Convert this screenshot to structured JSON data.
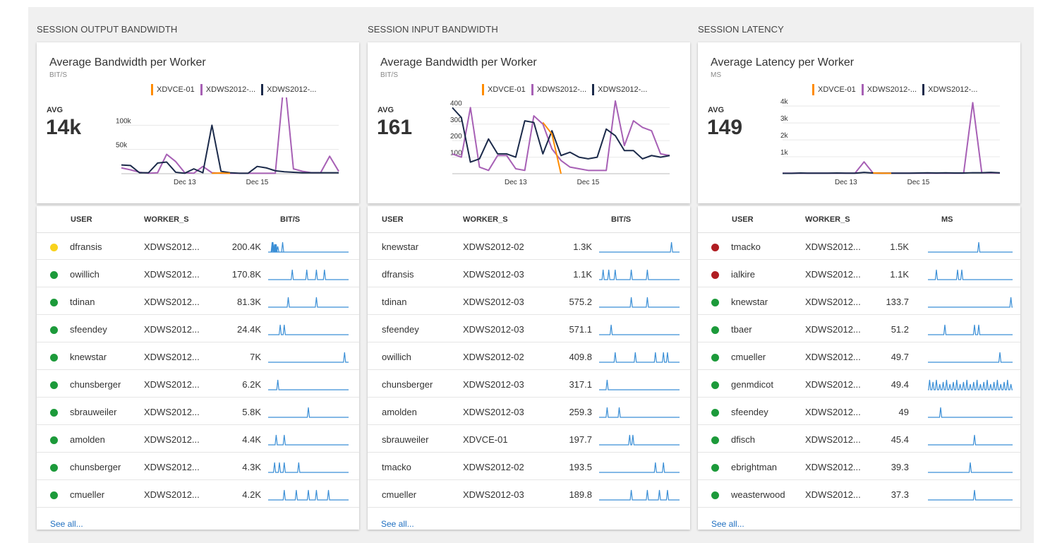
{
  "colors": {
    "orange": "#ff8c00",
    "purple": "#a760b5",
    "navy": "#1b2a4a",
    "spark": "#3b8fd6",
    "green": "#1c9a3a",
    "yellow": "#f8d21c",
    "red": "#b01d22",
    "link": "#1f6fc0"
  },
  "panels": [
    {
      "title": "SESSION OUTPUT BANDWIDTH",
      "chart_title": "Average Bandwidth per Worker",
      "unit": "BIT/S",
      "avg_label": "AVG",
      "avg_value": "14k",
      "legend": [
        "XDVCE-01",
        "XDWS2012-...",
        "XDWS2012-..."
      ],
      "y_ticks": [
        "100k",
        "50k"
      ],
      "x_ticks": [
        "Dec 13",
        "Dec 15"
      ],
      "columns": [
        "USER",
        "WORKER_S",
        "BIT/S"
      ],
      "show_status": true,
      "rows": [
        {
          "status": "yellow",
          "user": "dfransis",
          "worker": "XDWS2012...",
          "value": "200.4K"
        },
        {
          "status": "green",
          "user": "owillich",
          "worker": "XDWS2012...",
          "value": "170.8K"
        },
        {
          "status": "green",
          "user": "tdinan",
          "worker": "XDWS2012...",
          "value": "81.3K"
        },
        {
          "status": "green",
          "user": "sfeendey",
          "worker": "XDWS2012...",
          "value": "24.4K"
        },
        {
          "status": "green",
          "user": "knewstar",
          "worker": "XDWS2012...",
          "value": "7K"
        },
        {
          "status": "green",
          "user": "chunsberger",
          "worker": "XDWS2012...",
          "value": "6.2K"
        },
        {
          "status": "green",
          "user": "sbrauweiler",
          "worker": "XDWS2012...",
          "value": "5.8K"
        },
        {
          "status": "green",
          "user": "amolden",
          "worker": "XDWS2012...",
          "value": "4.4K"
        },
        {
          "status": "green",
          "user": "chunsberger",
          "worker": "XDWS2012...",
          "value": "4.3K"
        },
        {
          "status": "green",
          "user": "cmueller",
          "worker": "XDWS2012...",
          "value": "4.2K"
        }
      ],
      "see_all": "See all..."
    },
    {
      "title": "SESSION INPUT BANDWIDTH",
      "chart_title": "Average Bandwidth per Worker",
      "unit": "BIT/S",
      "avg_label": "AVG",
      "avg_value": "161",
      "legend": [
        "XDVCE-01",
        "XDWS2012-...",
        "XDWS2012-..."
      ],
      "y_ticks": [
        "400",
        "300",
        "200",
        "100"
      ],
      "x_ticks": [
        "Dec 13",
        "Dec 15"
      ],
      "columns": [
        "USER",
        "WORKER_S",
        "BIT/S"
      ],
      "show_status": false,
      "rows": [
        {
          "user": "knewstar",
          "worker": "XDWS2012-02",
          "value": "1.3K"
        },
        {
          "user": "dfransis",
          "worker": "XDWS2012-03",
          "value": "1.1K"
        },
        {
          "user": "tdinan",
          "worker": "XDWS2012-03",
          "value": "575.2"
        },
        {
          "user": "sfeendey",
          "worker": "XDWS2012-03",
          "value": "571.1"
        },
        {
          "user": "owillich",
          "worker": "XDWS2012-02",
          "value": "409.8"
        },
        {
          "user": "chunsberger",
          "worker": "XDWS2012-03",
          "value": "317.1"
        },
        {
          "user": "amolden",
          "worker": "XDWS2012-03",
          "value": "259.3"
        },
        {
          "user": "sbrauweiler",
          "worker": "XDVCE-01",
          "value": "197.7"
        },
        {
          "user": "tmacko",
          "worker": "XDWS2012-02",
          "value": "193.5"
        },
        {
          "user": "cmueller",
          "worker": "XDWS2012-03",
          "value": "189.8"
        }
      ],
      "see_all": "See all..."
    },
    {
      "title": "SESSION LATENCY",
      "chart_title": "Average Latency per Worker",
      "unit": "MS",
      "avg_label": "AVG",
      "avg_value": "149",
      "legend": [
        "XDVCE-01",
        "XDWS2012-...",
        "XDWS2012-..."
      ],
      "y_ticks": [
        "4k",
        "3k",
        "2k",
        "1k"
      ],
      "x_ticks": [
        "Dec 13",
        "Dec 15"
      ],
      "columns": [
        "USER",
        "WORKER_S",
        "MS"
      ],
      "show_status": true,
      "rows": [
        {
          "status": "red",
          "user": "tmacko",
          "worker": "XDWS2012...",
          "value": "1.5K"
        },
        {
          "status": "red",
          "user": "ialkire",
          "worker": "XDWS2012...",
          "value": "1.1K"
        },
        {
          "status": "green",
          "user": "knewstar",
          "worker": "XDWS2012...",
          "value": "133.7"
        },
        {
          "status": "green",
          "user": "tbaer",
          "worker": "XDWS2012...",
          "value": "51.2"
        },
        {
          "status": "green",
          "user": "cmueller",
          "worker": "XDWS2012...",
          "value": "49.7"
        },
        {
          "status": "green",
          "user": "genmdicot",
          "worker": "XDWS2012...",
          "value": "49.4"
        },
        {
          "status": "green",
          "user": "sfeendey",
          "worker": "XDWS2012...",
          "value": "49"
        },
        {
          "status": "green",
          "user": "dfisch",
          "worker": "XDWS2012...",
          "value": "45.4"
        },
        {
          "status": "green",
          "user": "ebrightman",
          "worker": "XDWS2012...",
          "value": "39.3"
        },
        {
          "status": "green",
          "user": "weasterwood",
          "worker": "XDWS2012...",
          "value": "37.3"
        }
      ],
      "see_all": "See all..."
    }
  ],
  "chart_data": [
    {
      "type": "line",
      "title": "Average Bandwidth per Worker",
      "ylabel": "BIT/S",
      "x_ticks": [
        "Dec 13",
        "Dec 15"
      ],
      "ylim": [
        0,
        150000
      ],
      "series": [
        {
          "name": "XDVCE-01",
          "color": "orange",
          "x": [
            10,
            11,
            12
          ],
          "values": [
            1000,
            1500,
            800
          ]
        },
        {
          "name": "XDWS2012-...",
          "color": "purple",
          "x": [
            0,
            1,
            2,
            3,
            4,
            5,
            6,
            7,
            8,
            9,
            10,
            11,
            12,
            13,
            14,
            15,
            16,
            17,
            18,
            19,
            20,
            21,
            22,
            23,
            24
          ],
          "values": [
            12000,
            8000,
            3000,
            1000,
            2000,
            40000,
            25000,
            2000,
            1000,
            15000,
            2000,
            1000,
            1000,
            1000,
            1000,
            1000,
            1000,
            1000,
            200000,
            10000,
            5000,
            2000,
            2000,
            36000,
            5000
          ]
        },
        {
          "name": "XDWS2012-...",
          "color": "navy",
          "x": [
            0,
            1,
            2,
            3,
            4,
            5,
            6,
            7,
            8,
            9,
            10,
            11,
            12,
            13,
            14,
            15,
            16,
            17,
            18,
            19,
            20,
            21,
            22,
            23,
            24
          ],
          "values": [
            18000,
            17000,
            2000,
            2000,
            22000,
            24000,
            3000,
            1000,
            10000,
            2000,
            100000,
            5000,
            2000,
            1000,
            1000,
            15000,
            12000,
            6000,
            4000,
            3000,
            2000,
            2000,
            2000,
            2000,
            2000
          ]
        }
      ]
    },
    {
      "type": "line",
      "title": "Average Bandwidth per Worker",
      "ylabel": "BIT/S",
      "x_ticks": [
        "Dec 13",
        "Dec 15"
      ],
      "ylim": [
        0,
        440
      ],
      "series": [
        {
          "name": "XDVCE-01",
          "color": "orange",
          "x": [
            10,
            11,
            12
          ],
          "values": [
            310,
            240,
            0
          ]
        },
        {
          "name": "XDWS2012-...",
          "color": "purple",
          "x": [
            0,
            1,
            2,
            3,
            4,
            5,
            6,
            7,
            8,
            9,
            10,
            11,
            12,
            13,
            14,
            15,
            16,
            17,
            18,
            19,
            20,
            21,
            22,
            23,
            24
          ],
          "values": [
            120,
            100,
            400,
            40,
            20,
            110,
            110,
            30,
            20,
            350,
            300,
            150,
            80,
            40,
            30,
            20,
            20,
            20,
            440,
            170,
            320,
            280,
            260,
            120,
            110
          ]
        },
        {
          "name": "XDWS2012-...",
          "color": "navy",
          "x": [
            0,
            1,
            2,
            3,
            4,
            5,
            6,
            7,
            8,
            9,
            10,
            11,
            12,
            13,
            14,
            15,
            16,
            17,
            18,
            19,
            20,
            21,
            22,
            23,
            24
          ],
          "values": [
            400,
            340,
            70,
            90,
            210,
            120,
            120,
            100,
            320,
            310,
            120,
            260,
            110,
            130,
            100,
            90,
            100,
            270,
            230,
            140,
            140,
            90,
            110,
            100,
            110
          ]
        }
      ]
    },
    {
      "type": "line",
      "title": "Average Latency per Worker",
      "ylabel": "MS",
      "x_ticks": [
        "Dec 13",
        "Dec 15"
      ],
      "ylim": [
        0,
        4300
      ],
      "series": [
        {
          "name": "XDVCE-01",
          "color": "orange",
          "x": [
            10,
            11,
            12
          ],
          "values": [
            40,
            30,
            20
          ]
        },
        {
          "name": "XDWS2012-...",
          "color": "purple",
          "x": [
            0,
            1,
            2,
            3,
            4,
            5,
            6,
            7,
            8,
            9,
            10,
            11,
            12,
            13,
            14,
            15,
            16,
            17,
            18,
            19,
            20,
            21,
            22,
            23,
            24
          ],
          "values": [
            30,
            30,
            30,
            30,
            30,
            30,
            30,
            30,
            30,
            700,
            30,
            30,
            30,
            30,
            30,
            30,
            30,
            30,
            30,
            30,
            30,
            4200,
            50,
            50,
            40
          ]
        },
        {
          "name": "XDWS2012-...",
          "color": "navy",
          "x": [
            0,
            1,
            2,
            3,
            4,
            5,
            6,
            7,
            8,
            9,
            10,
            11,
            12,
            13,
            14,
            15,
            16,
            17,
            18,
            19,
            20,
            21,
            22,
            23,
            24
          ],
          "values": [
            20,
            20,
            40,
            30,
            30,
            30,
            40,
            30,
            30,
            80,
            40,
            30,
            30,
            30,
            30,
            40,
            50,
            40,
            50,
            40,
            40,
            60,
            60,
            80,
            50
          ]
        }
      ]
    }
  ]
}
